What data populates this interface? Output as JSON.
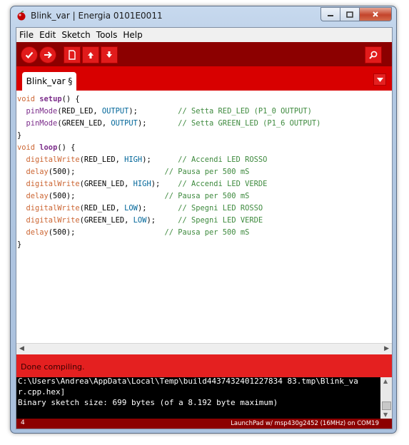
{
  "window": {
    "title": "Blink_var | Energia 0101E0011",
    "minimize_icon": "minimize-icon",
    "maximize_icon": "maximize-icon",
    "close_icon": "close-icon"
  },
  "menu": [
    "File",
    "Edit",
    "Sketch",
    "Tools",
    "Help"
  ],
  "toolbar": {
    "buttons": [
      "verify-icon",
      "upload-icon",
      "new-icon",
      "open-icon",
      "save-icon"
    ],
    "serial_monitor": "serial-monitor-icon"
  },
  "tab": {
    "label": "Blink_var §"
  },
  "code": {
    "l1": {
      "kw": "void",
      "fn": "setup",
      "rest": "() {"
    },
    "l2": {
      "pre": "  ",
      "fn": "pinMode",
      "args1": "(RED_LED, ",
      "const": "OUTPUT",
      "args2": ");         ",
      "comment": "// Setta RED_LED (P1_0 OUTPUT)"
    },
    "l3": {
      "pre": "  ",
      "fn": "pinMode",
      "args1": "(GREEN_LED, ",
      "const": "OUTPUT",
      "args2": ");       ",
      "comment": "// Setta GREEN_LED (P1_6 OUTPUT)"
    },
    "l4": {
      "text": "}"
    },
    "l5": {
      "kw": "void",
      "fn": "loop",
      "rest": "() {"
    },
    "l6": {
      "pre": "  ",
      "fn": "digitalWrite",
      "args1": "(RED_LED, ",
      "const": "HIGH",
      "args2": ");      ",
      "comment": "// Accendi LED ROSSO"
    },
    "l7": {
      "pre": "  ",
      "fn": "delay",
      "args1": "(500);",
      "args2": "                    ",
      "comment": "// Pausa per 500 mS"
    },
    "l8": {
      "pre": "  ",
      "fn": "digitalWrite",
      "args1": "(GREEN_LED, ",
      "const": "HIGH",
      "args2": ");    ",
      "comment": "// Accendi LED VERDE"
    },
    "l9": {
      "pre": "  ",
      "fn": "delay",
      "args1": "(500);",
      "args2": "                    ",
      "comment": "// Pausa per 500 mS"
    },
    "l10": {
      "pre": "  ",
      "fn": "digitalWrite",
      "args1": "(RED_LED, ",
      "const": "LOW",
      "args2": ");       ",
      "comment": "// Spegni LED ROSSO"
    },
    "l11": {
      "pre": "  ",
      "fn": "digitalWrite",
      "args1": "(GREEN_LED, ",
      "const": "LOW",
      "args2": ");     ",
      "comment": "// Spegni LED VERDE"
    },
    "l12": {
      "pre": "  ",
      "fn": "delay",
      "args1": "(500);",
      "args2": "                    ",
      "comment": "// Pausa per 500 mS"
    },
    "l13": {
      "text": "}"
    }
  },
  "status": {
    "message": "Done compiling."
  },
  "console": {
    "lines": [
      "C:\\Users\\Andrea\\AppData\\Local\\Temp\\build4437432401227834 83.tmp\\Blink_va",
      "r.cpp.hex]",
      "Binary sketch size: 699 bytes (of a 8.192 byte maximum)"
    ]
  },
  "bottom": {
    "line_number": "4",
    "board": "LaunchPad w/ msp430g2452 (16MHz) on COM19"
  },
  "colors": {
    "toolbar": "#8c0000",
    "tabbar": "#d80000",
    "status": "#e42020",
    "keyword": "#cc6633",
    "function": "#7b2c8a",
    "constant": "#006699",
    "comment": "#3e8a3e"
  }
}
